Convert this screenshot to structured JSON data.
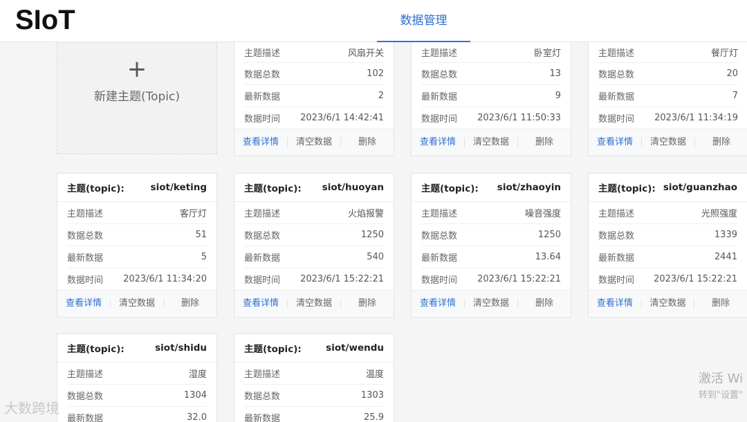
{
  "app": {
    "logo": "SIoT",
    "nav_tab": "数据管理"
  },
  "new_topic": {
    "plus": "+",
    "label": "新建主题(Topic)"
  },
  "labels": {
    "topic": "主题(topic):",
    "desc": "主题描述",
    "total": "数据总数",
    "latest": "最新数据",
    "time": "数据时间",
    "view": "查看详情",
    "clear": "清空数据",
    "delete": "删除"
  },
  "cards": [
    {
      "topic": "",
      "desc": "风扇开关",
      "total": "102",
      "latest": "2",
      "time": "2023/6/1 14:42:41"
    },
    {
      "topic": "",
      "desc": "卧室灯",
      "total": "13",
      "latest": "9",
      "time": "2023/6/1 11:50:33"
    },
    {
      "topic": "",
      "desc": "餐厅灯",
      "total": "20",
      "latest": "7",
      "time": "2023/6/1 11:34:19"
    },
    {
      "topic": "siot/keting",
      "desc": "客厅灯",
      "total": "51",
      "latest": "5",
      "time": "2023/6/1 11:34:20"
    },
    {
      "topic": "siot/huoyan",
      "desc": "火焰报警",
      "total": "1250",
      "latest": "540",
      "time": "2023/6/1 15:22:21"
    },
    {
      "topic": "siot/zhaoyin",
      "desc": "噪音强度",
      "total": "1250",
      "latest": "13.64",
      "time": "2023/6/1 15:22:21"
    },
    {
      "topic": "siot/guanzhao",
      "desc": "光照强度",
      "total": "1339",
      "latest": "2441",
      "time": "2023/6/1 15:22:21"
    },
    {
      "topic": "siot/shidu",
      "desc": "湿度",
      "total": "1304",
      "latest": "32.0",
      "time": ""
    },
    {
      "topic": "siot/wendu",
      "desc": "温度",
      "total": "1303",
      "latest": "25.9",
      "time": ""
    }
  ],
  "overlay": {
    "activate_line1": "激活 Wi",
    "activate_line2": "转到\"设置\"",
    "watermark": "大数跨境"
  }
}
